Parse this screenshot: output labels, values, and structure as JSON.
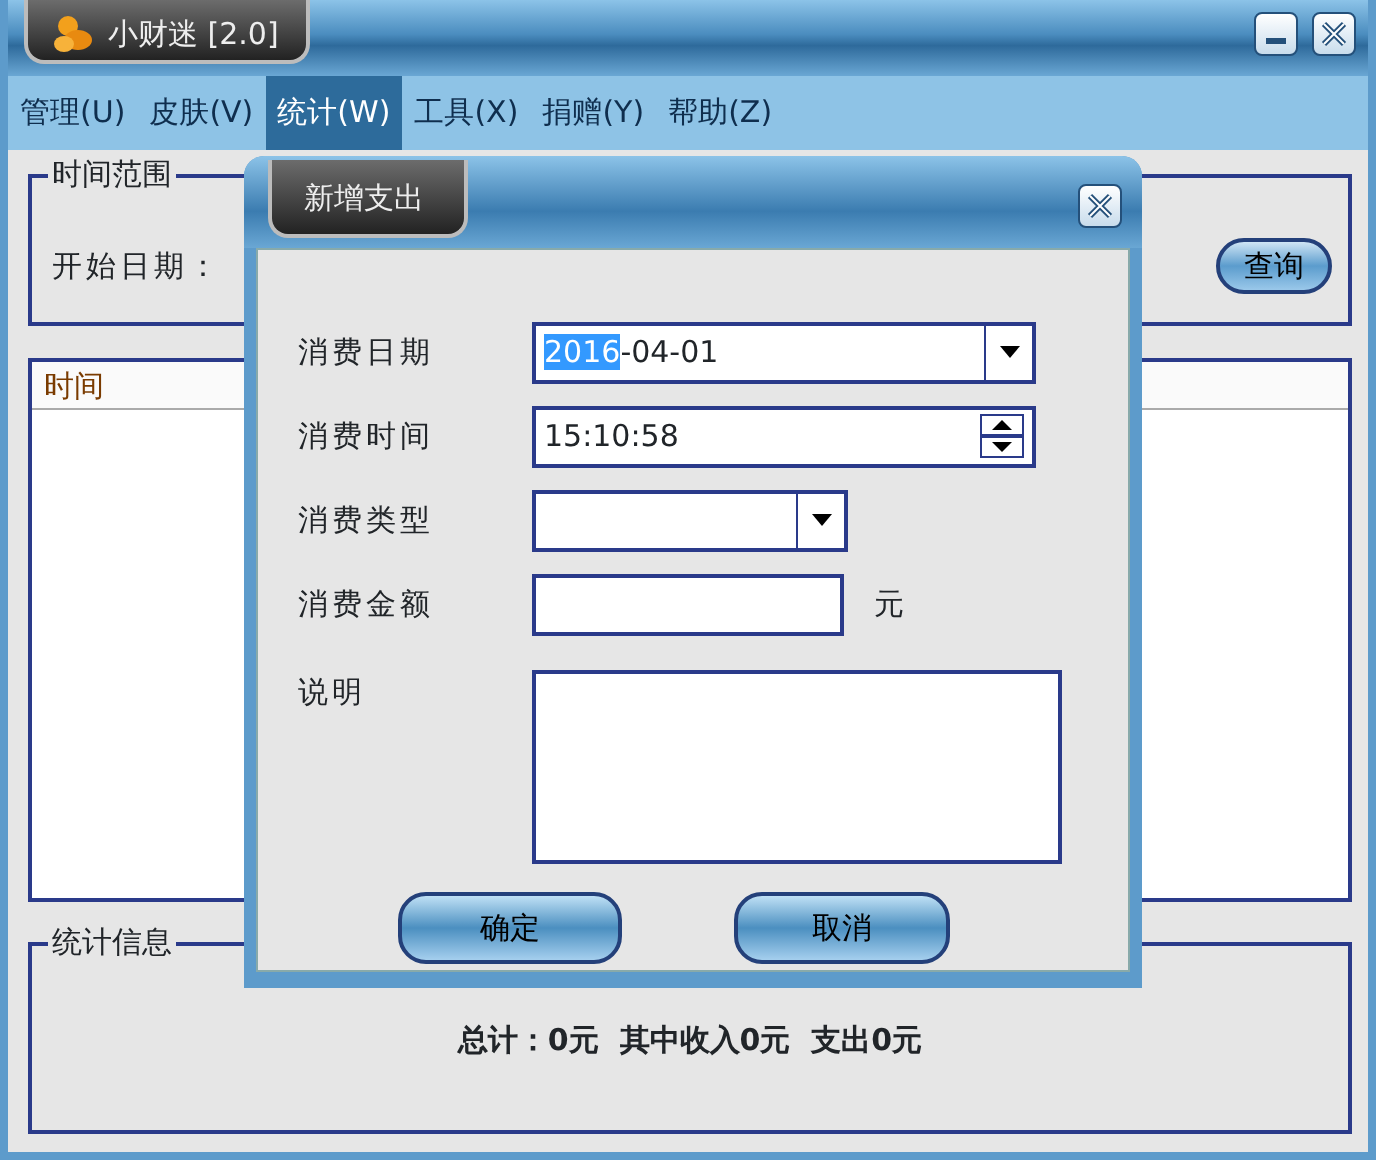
{
  "window": {
    "title": "小财迷 [2.0]"
  },
  "menu": [
    {
      "label": "管理(U)",
      "selected": false
    },
    {
      "label": "皮肤(V)",
      "selected": false
    },
    {
      "label": "统计(W)",
      "selected": true
    },
    {
      "label": "工具(X)",
      "selected": false
    },
    {
      "label": "捐赠(Y)",
      "selected": false
    },
    {
      "label": "帮助(Z)",
      "selected": false
    }
  ],
  "time_range": {
    "title": "时间范围",
    "start_label": "开始日期：",
    "query_button": "查询"
  },
  "list": {
    "columns": [
      "时间"
    ]
  },
  "stats": {
    "title": "统计信息",
    "summary": "总计：0元  其中收入0元  支出0元"
  },
  "dialog": {
    "title": "新增支出",
    "fields": [
      {
        "kind": "date",
        "label": "消费日期",
        "value_selected": "2016",
        "value": "-04-01"
      },
      {
        "kind": "time",
        "label": "消费时间",
        "value": "15:10:58"
      },
      {
        "kind": "combo",
        "label": "消费类型"
      },
      {
        "kind": "amount",
        "label": "消费金额",
        "unit": "元"
      },
      {
        "kind": "memo",
        "label": "说明"
      }
    ],
    "buttons": [
      "确定",
      "取消"
    ]
  }
}
